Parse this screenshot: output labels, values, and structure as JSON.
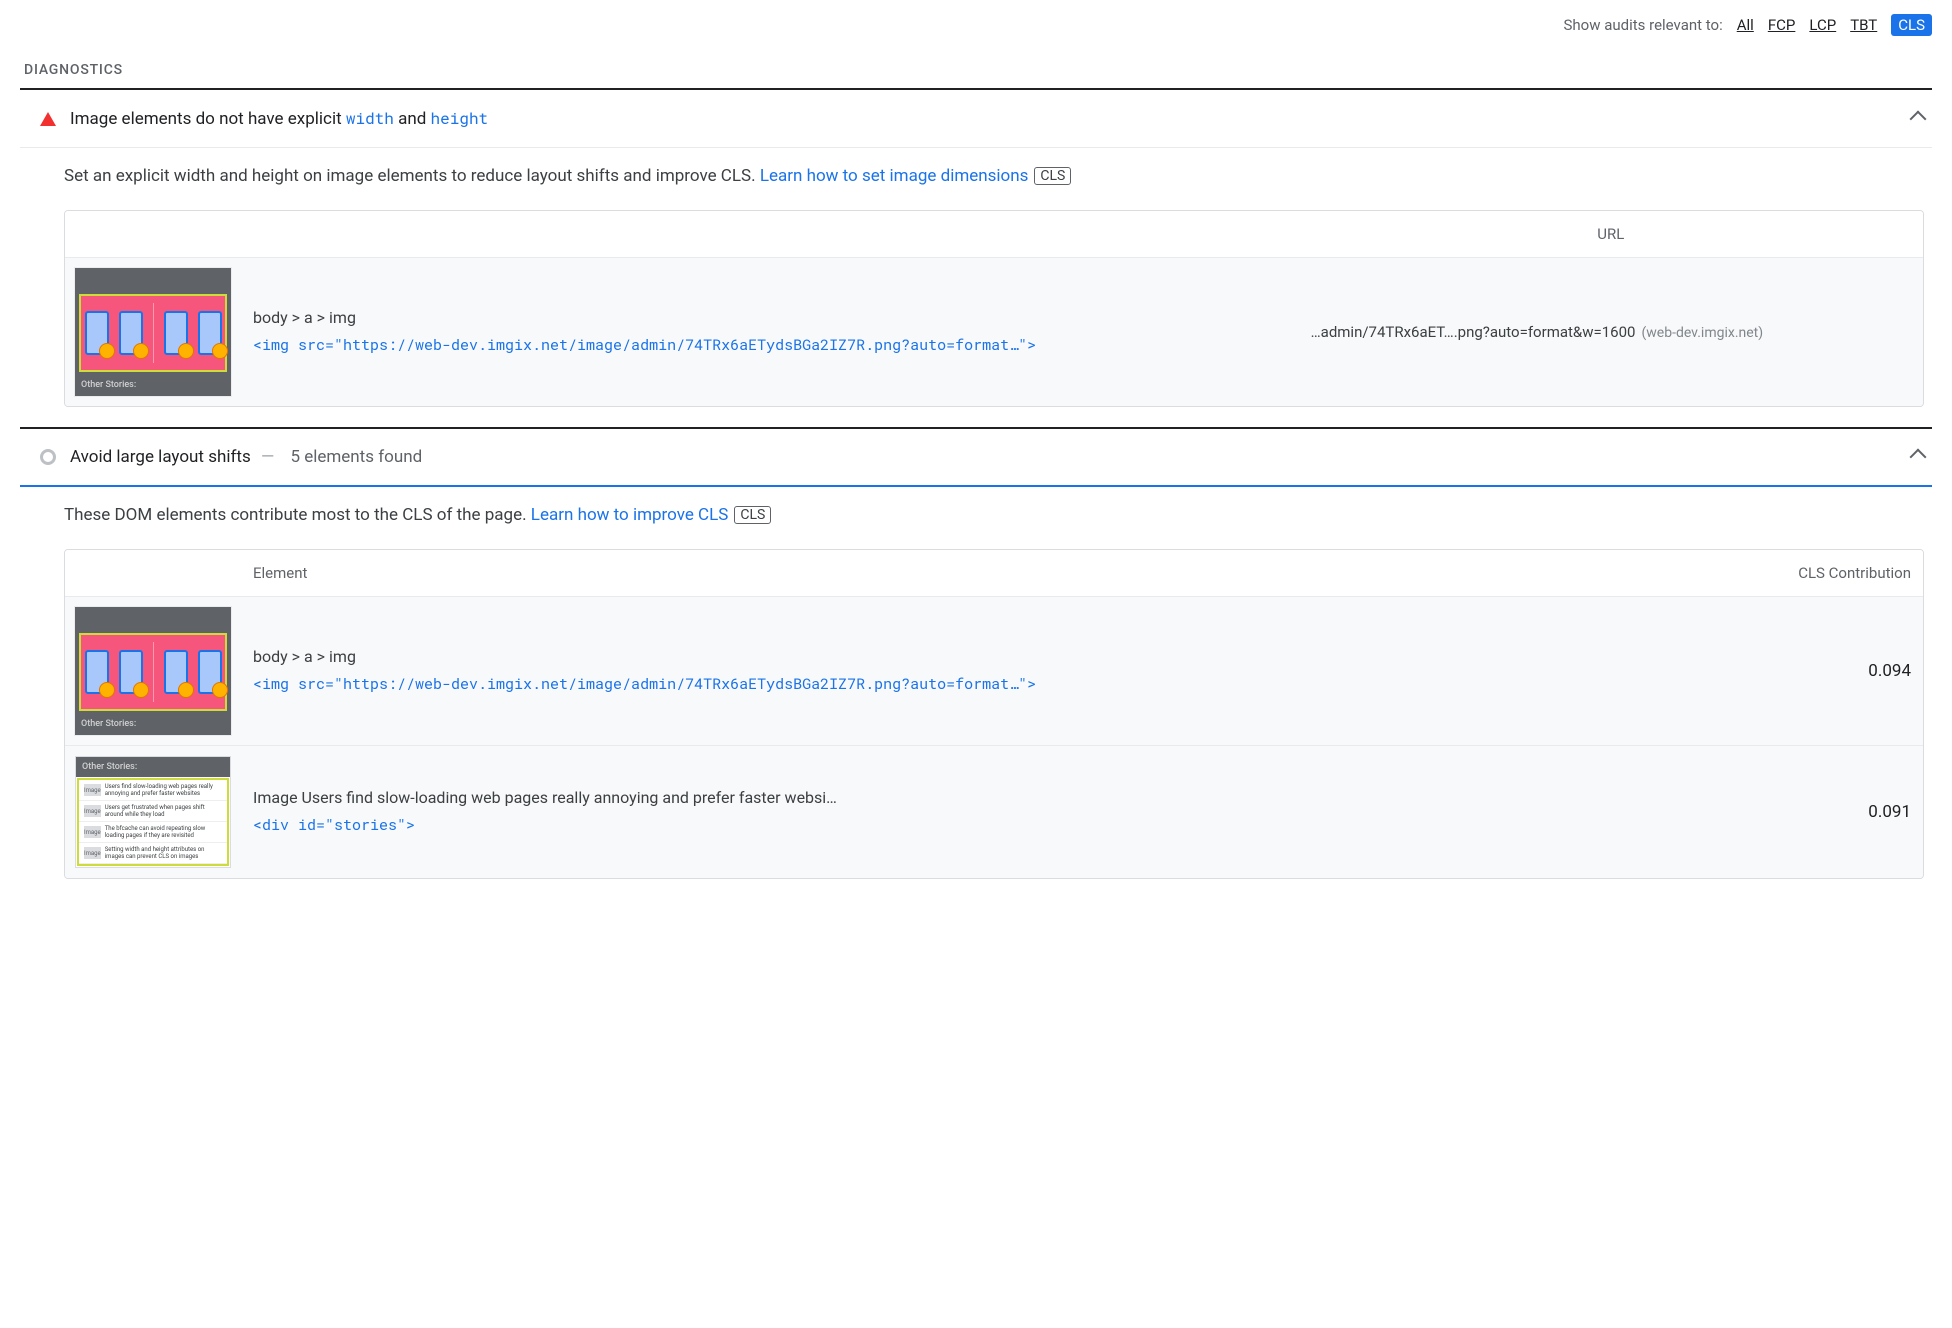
{
  "filter": {
    "label": "Show audits relevant to:",
    "items": [
      "All",
      "FCP",
      "LCP",
      "TBT",
      "CLS"
    ],
    "active": "CLS"
  },
  "section": "DIAGNOSTICS",
  "audit1": {
    "title_pre": "Image elements do not have explicit ",
    "code1": "width",
    "mid": " and ",
    "code2": "height",
    "desc": "Set an explicit width and height on image elements to reduce layout shifts and improve CLS. ",
    "link": "Learn how to set image dimensions",
    "badge": "CLS",
    "table": {
      "col_url": "URL",
      "row": {
        "thumb_label": "Other Stories:",
        "selector": "body > a > img",
        "code": "<img src=\"https://web-dev.imgix.net/image/admin/74TRx6aETydsBGa2IZ7R.png?auto=format…\">",
        "url": "…admin/74TRx6aET….png?auto=format&w=1600",
        "url_host": "(web-dev.imgix.net)"
      }
    }
  },
  "audit2": {
    "title": "Avoid large layout shifts",
    "sub": "5 elements found",
    "desc": "These DOM elements contribute most to the CLS of the page. ",
    "link": "Learn how to improve CLS",
    "badge": "CLS",
    "table": {
      "col_element": "Element",
      "col_cls": "CLS Contribution",
      "rows": [
        {
          "thumb_label": "Other Stories:",
          "selector": "body > a > img",
          "code": "<img src=\"https://web-dev.imgix.net/image/admin/74TRx6aETydsBGa2IZ7R.png?auto=format…\">",
          "cls": "0.094"
        },
        {
          "thumb_header": "Other Stories:",
          "stories": [
            "Users find slow-loading web pages really annoying and prefer faster websites",
            "Users get frustrated when pages shift around while they load",
            "The bfcache can avoid repeating slow loading pages if they are revisited",
            "Setting width and height attributes on images can prevent CLS on images"
          ],
          "selector": "Image Users find slow-loading web pages really annoying and prefer faster websi…",
          "code": "<div id=\"stories\">",
          "cls": "0.091"
        }
      ]
    }
  }
}
